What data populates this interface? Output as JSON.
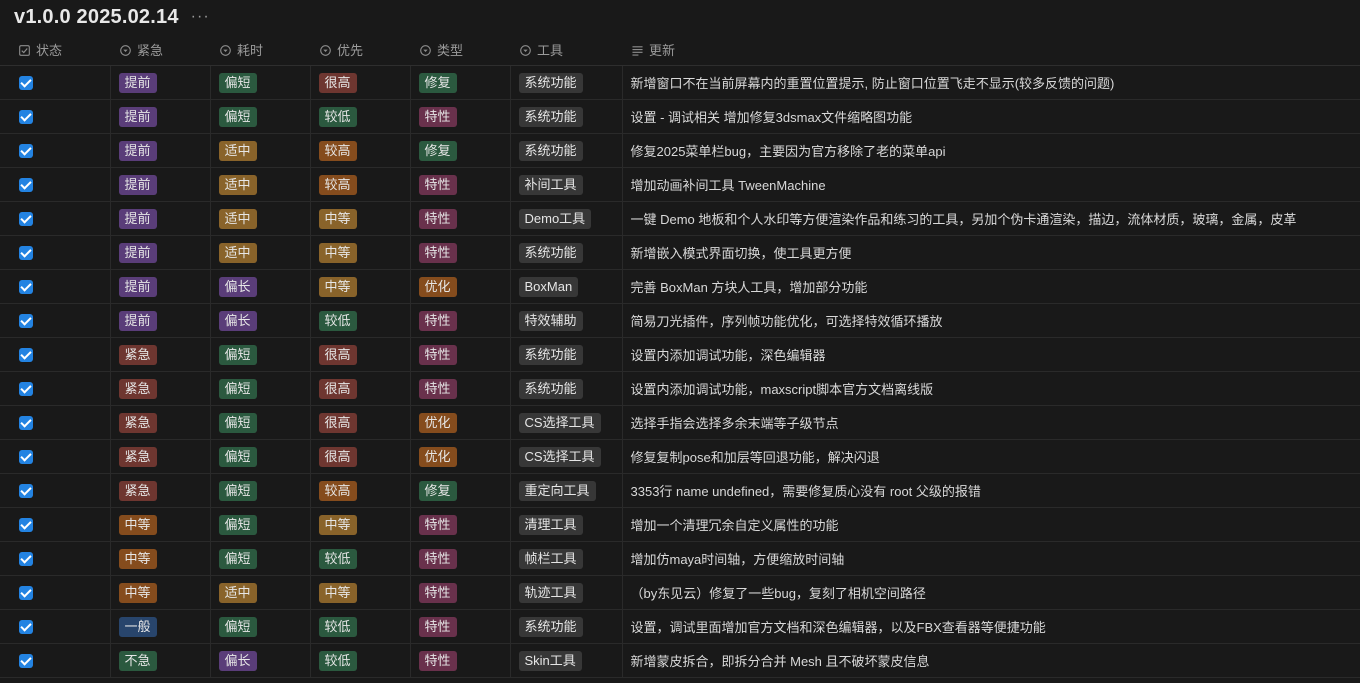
{
  "header": {
    "title": "v1.0.0 2025.02.14",
    "more_label": "···"
  },
  "columns": [
    {
      "label": "状态",
      "icon": "checkbox-icon"
    },
    {
      "label": "紧急",
      "icon": "select-icon"
    },
    {
      "label": "耗时",
      "icon": "select-icon"
    },
    {
      "label": "优先",
      "icon": "select-icon"
    },
    {
      "label": "类型",
      "icon": "select-icon"
    },
    {
      "label": "工具",
      "icon": "select-icon"
    },
    {
      "label": "更新",
      "icon": "text-lines-icon"
    }
  ],
  "tag_colors": {
    "提前": "purple",
    "紧急": "red",
    "中等": "orange",
    "一般": "blue",
    "不急": "green",
    "偏短": "green",
    "适中": "yellow",
    "偏长": "purple",
    "很高": "red",
    "较低": "green",
    "较高": "orange",
    "中等P": "yellow",
    "修复": "green",
    "特性": "pink",
    "优化": "orange"
  },
  "rows": [
    {
      "done": true,
      "urgency": "提前",
      "time": "偏短",
      "priority": "很高",
      "type": "修复",
      "tool": "系统功能",
      "update": "新增窗口不在当前屏幕内的重置位置提示, 防止窗口位置飞走不显示(较多反馈的问题)"
    },
    {
      "done": true,
      "urgency": "提前",
      "time": "偏短",
      "priority": "较低",
      "type": "特性",
      "tool": "系统功能",
      "update": "设置 - 调试相关 增加修复3dsmax文件缩略图功能"
    },
    {
      "done": true,
      "urgency": "提前",
      "time": "适中",
      "priority": "较高",
      "type": "修复",
      "tool": "系统功能",
      "update": "修复2025菜单栏bug，主要因为官方移除了老的菜单api"
    },
    {
      "done": true,
      "urgency": "提前",
      "time": "适中",
      "priority": "较高",
      "type": "特性",
      "tool": "补间工具",
      "update": "增加动画补间工具 TweenMachine"
    },
    {
      "done": true,
      "urgency": "提前",
      "time": "适中",
      "priority": "中等",
      "type": "特性",
      "tool": "Demo工具",
      "update": "一键 Demo 地板和个人水印等方便渲染作品和练习的工具，另加个伪卡通渲染，描边，流体材质，玻璃，金属，皮革"
    },
    {
      "done": true,
      "urgency": "提前",
      "time": "适中",
      "priority": "中等",
      "type": "特性",
      "tool": "系统功能",
      "update": "新增嵌入模式界面切换，使工具更方便"
    },
    {
      "done": true,
      "urgency": "提前",
      "time": "偏长",
      "priority": "中等",
      "type": "优化",
      "tool": "BoxMan",
      "update": "完善 BoxMan 方块人工具，增加部分功能"
    },
    {
      "done": true,
      "urgency": "提前",
      "time": "偏长",
      "priority": "较低",
      "type": "特性",
      "tool": "特效辅助",
      "update": "简易刀光插件，序列帧功能优化，可选择特效循环播放"
    },
    {
      "done": true,
      "urgency": "紧急",
      "time": "偏短",
      "priority": "很高",
      "type": "特性",
      "tool": "系统功能",
      "update": "设置内添加调试功能，深色编辑器"
    },
    {
      "done": true,
      "urgency": "紧急",
      "time": "偏短",
      "priority": "很高",
      "type": "特性",
      "tool": "系统功能",
      "update": "设置内添加调试功能，maxscript脚本官方文档离线版"
    },
    {
      "done": true,
      "urgency": "紧急",
      "time": "偏短",
      "priority": "很高",
      "type": "优化",
      "tool": "CS选择工具",
      "update": "选择手指会选择多余末端等子级节点"
    },
    {
      "done": true,
      "urgency": "紧急",
      "time": "偏短",
      "priority": "很高",
      "type": "优化",
      "tool": "CS选择工具",
      "update": "修复复制pose和加层等回退功能，解决闪退"
    },
    {
      "done": true,
      "urgency": "紧急",
      "time": "偏短",
      "priority": "较高",
      "type": "修复",
      "tool": "重定向工具",
      "update": "3353行 name undefined，需要修复质心没有 root 父级的报错"
    },
    {
      "done": true,
      "urgency": "中等",
      "time": "偏短",
      "priority": "中等",
      "type": "特性",
      "tool": "清理工具",
      "update": "增加一个清理冗余自定义属性的功能"
    },
    {
      "done": true,
      "urgency": "中等",
      "time": "偏短",
      "priority": "较低",
      "type": "特性",
      "tool": "帧栏工具",
      "update": "增加仿maya时间轴，方便缩放时间轴"
    },
    {
      "done": true,
      "urgency": "中等",
      "time": "适中",
      "priority": "中等",
      "type": "特性",
      "tool": "轨迹工具",
      "update": "（by东见云）修复了一些bug，复刻了相机空间路径"
    },
    {
      "done": true,
      "urgency": "一般",
      "time": "偏短",
      "priority": "较低",
      "type": "特性",
      "tool": "系统功能",
      "update": "设置，调试里面增加官方文档和深色编辑器，以及FBX查看器等便捷功能"
    },
    {
      "done": true,
      "urgency": "不急",
      "time": "偏长",
      "priority": "较低",
      "type": "特性",
      "tool": "Skin工具",
      "update": "新增蒙皮拆合，即拆分合并 Mesh 且不破坏蒙皮信息"
    }
  ]
}
